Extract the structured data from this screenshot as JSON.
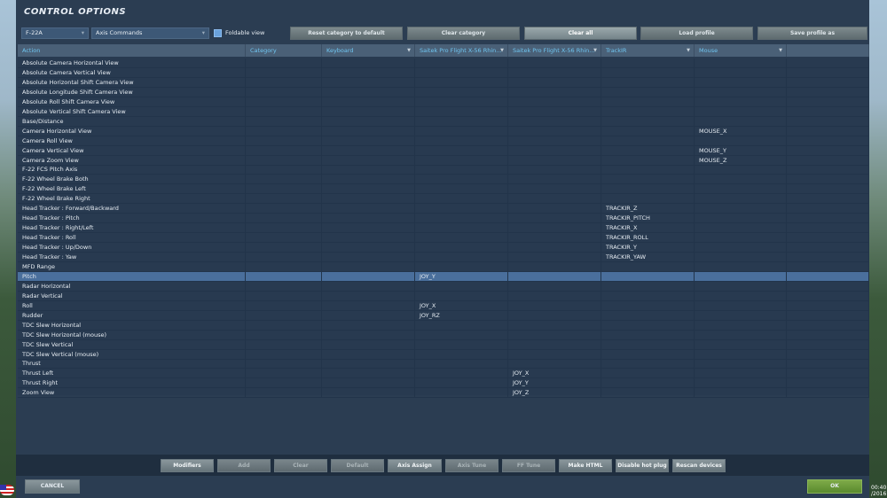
{
  "title": "CONTROL OPTIONS",
  "toolbar": {
    "aircraft": "F-22A",
    "category": "Axis Commands",
    "foldable_label": "Foldable view",
    "foldable_checked": true,
    "buttons": [
      "Reset category to default",
      "Clear category",
      "Clear all",
      "Load profile",
      "Save profile as"
    ]
  },
  "columns": [
    "Action",
    "Category",
    "Keyboard",
    "Saitek Pro Flight X-56 Rhin...",
    "Saitek Pro Flight X-56 Rhin...",
    "TrackIR",
    "Mouse",
    ""
  ],
  "rows": [
    [
      "Absolute Camera Horizontal View",
      "",
      "",
      "",
      "",
      "",
      ""
    ],
    [
      "Absolute Camera Vertical View",
      "",
      "",
      "",
      "",
      "",
      ""
    ],
    [
      "Absolute Horizontal Shift Camera View",
      "",
      "",
      "",
      "",
      "",
      ""
    ],
    [
      "Absolute Longitude Shift Camera View",
      "",
      "",
      "",
      "",
      "",
      ""
    ],
    [
      "Absolute Roll Shift Camera View",
      "",
      "",
      "",
      "",
      "",
      ""
    ],
    [
      "Absolute Vertical Shift Camera View",
      "",
      "",
      "",
      "",
      "",
      ""
    ],
    [
      "Base/Distance",
      "",
      "",
      "",
      "",
      "",
      ""
    ],
    [
      "Camera Horizontal View",
      "",
      "",
      "",
      "",
      "",
      "MOUSE_X"
    ],
    [
      "Camera Roll View",
      "",
      "",
      "",
      "",
      "",
      ""
    ],
    [
      "Camera Vertical View",
      "",
      "",
      "",
      "",
      "",
      "MOUSE_Y"
    ],
    [
      "Camera Zoom View",
      "",
      "",
      "",
      "",
      "",
      "MOUSE_Z"
    ],
    [
      "F-22 FCS Pitch Axis",
      "",
      "",
      "",
      "",
      "",
      ""
    ],
    [
      "F-22 Wheel Brake Both",
      "",
      "",
      "",
      "",
      "",
      ""
    ],
    [
      "F-22 Wheel Brake Left",
      "",
      "",
      "",
      "",
      "",
      ""
    ],
    [
      "F-22 Wheel Brake Right",
      "",
      "",
      "",
      "",
      "",
      ""
    ],
    [
      "Head Tracker : Forward/Backward",
      "",
      "",
      "",
      "",
      "TRACKIR_Z",
      ""
    ],
    [
      "Head Tracker : Pitch",
      "",
      "",
      "",
      "",
      "TRACKIR_PITCH",
      ""
    ],
    [
      "Head Tracker : Right/Left",
      "",
      "",
      "",
      "",
      "TRACKIR_X",
      ""
    ],
    [
      "Head Tracker : Roll",
      "",
      "",
      "",
      "",
      "TRACKIR_ROLL",
      ""
    ],
    [
      "Head Tracker : Up/Down",
      "",
      "",
      "",
      "",
      "TRACKIR_Y",
      ""
    ],
    [
      "Head Tracker : Yaw",
      "",
      "",
      "",
      "",
      "TRACKIR_YAW",
      ""
    ],
    [
      "MFD Range",
      "",
      "",
      "",
      "",
      "",
      ""
    ],
    [
      "Pitch",
      "",
      "",
      "JOY_Y",
      "",
      "",
      ""
    ],
    [
      "Radar Horizontal",
      "",
      "",
      "",
      "",
      "",
      ""
    ],
    [
      "Radar Vertical",
      "",
      "",
      "",
      "",
      "",
      ""
    ],
    [
      "Roll",
      "",
      "",
      "JOY_X",
      "",
      "",
      ""
    ],
    [
      "Rudder",
      "",
      "",
      "JOY_RZ",
      "",
      "",
      ""
    ],
    [
      "TDC Slew Horizontal",
      "",
      "",
      "",
      "",
      "",
      ""
    ],
    [
      "TDC Slew Horizontal (mouse)",
      "",
      "",
      "",
      "",
      "",
      ""
    ],
    [
      "TDC Slew Vertical",
      "",
      "",
      "",
      "",
      "",
      ""
    ],
    [
      "TDC Slew Vertical (mouse)",
      "",
      "",
      "",
      "",
      "",
      ""
    ],
    [
      "Thrust",
      "",
      "",
      "",
      "",
      "",
      ""
    ],
    [
      "Thrust Left",
      "",
      "",
      "",
      "JOY_X",
      "",
      ""
    ],
    [
      "Thrust Right",
      "",
      "",
      "",
      "JOY_Y",
      "",
      ""
    ],
    [
      "Zoom View",
      "",
      "",
      "",
      "JOY_Z",
      "",
      ""
    ]
  ],
  "selected_row": 22,
  "bottom_buttons": [
    {
      "label": "Modifiers",
      "enabled": true
    },
    {
      "label": "Add",
      "enabled": false
    },
    {
      "label": "Clear",
      "enabled": false
    },
    {
      "label": "Default",
      "enabled": false
    },
    {
      "label": "Axis Assign",
      "enabled": true
    },
    {
      "label": "Axis Tune",
      "enabled": false
    },
    {
      "label": "FF Tune",
      "enabled": false
    },
    {
      "label": "Make HTML",
      "enabled": true
    },
    {
      "label": "Disable hot plug",
      "enabled": true
    },
    {
      "label": "Rescan devices",
      "enabled": true
    }
  ],
  "cancel_label": "CANCEL",
  "ok_label": "OK",
  "clock": {
    "time": "00:40",
    "date": "/2016"
  }
}
